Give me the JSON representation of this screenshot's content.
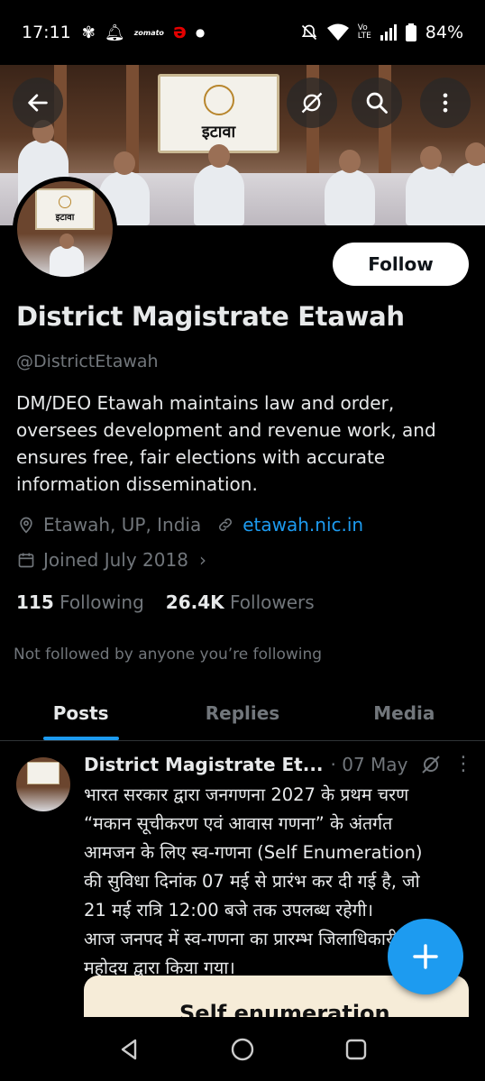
{
  "status_bar": {
    "time": "17:11",
    "zomato_label": "zomato",
    "battery": "84%"
  },
  "profile": {
    "banner_board_text": "इटावा",
    "avatar_board_text": "इटावा",
    "follow_label": "Follow",
    "display_name": "District Magistrate Etawah",
    "handle": "@DistrictEtawah",
    "bio": "DM/DEO Etawah maintains law and order, oversees development and revenue work, and ensures free, fair elections with accurate information dissemination.",
    "location": "Etawah, UP, India",
    "website": "etawah.nic.in",
    "joined": "Joined July 2018",
    "following_count": "115",
    "following_label": "Following",
    "followers_count": "26.4K",
    "followers_label": "Followers",
    "not_followed": "Not followed by anyone you’re following"
  },
  "tabs": [
    {
      "label": "Posts",
      "active": true
    },
    {
      "label": "Replies",
      "active": false
    },
    {
      "label": "Media",
      "active": false
    }
  ],
  "post": {
    "author": "District Magistrate Et...",
    "date": "· 07 May",
    "text": "भारत सरकार द्वारा जनगणना 2027 के प्रथम चरण\n“मकान सूचीकरण एवं आवास गणना” के अंतर्गत\nआमजन के लिए स्व-गणना (Self Enumeration)\nकी सुविधा दिनांक 07 मई से प्रारंभ कर दी गई है, जो\n21 मई रात्रि 12:00 बजे तक उपलब्ध रहेगी।\nआज जनपद में स्व-गणना का प्रारम्भ जिलाधिकारी\nमहोदय द्वारा किया गया।",
    "card_title": "Self enumeration"
  },
  "colors": {
    "accent": "#1d9bf0",
    "secondary_text": "#71767b",
    "primary_text": "#e7e9ea",
    "background": "#000000"
  }
}
